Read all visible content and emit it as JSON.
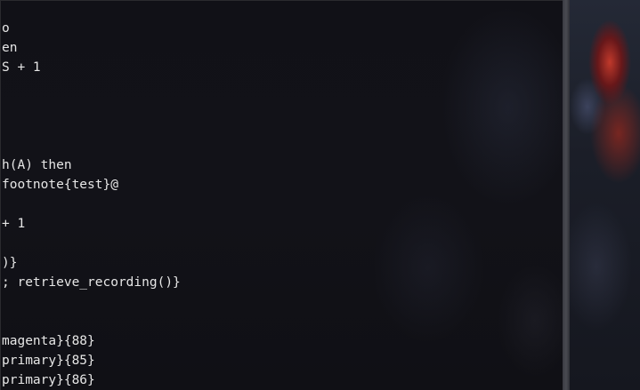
{
  "terminal": {
    "lines": [
      "o",
      "en",
      "S + 1",
      "",
      "",
      "",
      "",
      "h(A) then",
      "footnote{test}@",
      "",
      "+ 1",
      "",
      ")}",
      "; retrieve_recording()}",
      "",
      "",
      "magenta}{88}",
      "primary}{85}",
      "primary}{86}"
    ]
  },
  "colors": {
    "terminal_bg": "#111117",
    "terminal_text": "#e6e6e6",
    "divider": "#4a4b52",
    "wallpaper_accent": "#c0392b"
  }
}
